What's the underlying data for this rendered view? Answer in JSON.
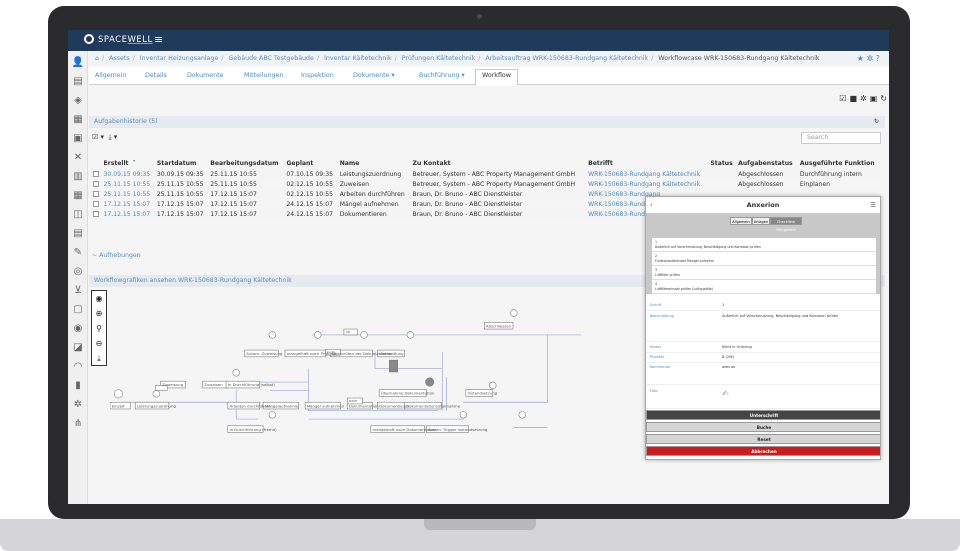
{
  "app": {
    "logo_left": "SPACE",
    "logo_right": "WELL"
  },
  "breadcrumb": [
    "Assets",
    "Inventar Heizungsanlage",
    "Gebäude ABC Testgebäude",
    "Inventar Kältetechnik",
    "Prüfungen Kältetechnik",
    "Arbeitsauftrag WRK-150683-Rundgang Kältetechnik",
    "Workflowcase WRK-150683-Rundgang Kältetechnik"
  ],
  "tabs": [
    "Allgemein",
    "Details",
    "Dokumente",
    "Mitteilungen",
    "Inspektion",
    "Dokumente ▾",
    "Buchführung ▾",
    "Workflow"
  ],
  "history": {
    "title": "Aufgabenhistorie (5)",
    "search_placeholder": "Search",
    "columns": [
      "Erstellt",
      "Startdatum",
      "Bearbeitungsdatum",
      "Geplant",
      "Name",
      "Zu Kontakt",
      "Betrifft",
      "Status",
      "Aufgabenstatus",
      "Ausgeführte Funktion"
    ],
    "rows": [
      [
        "30.09.15 09:35",
        "30.09.15 09:35",
        "25.11.15 10:55",
        "07.10.15 09:35",
        "Leistungszuordnung",
        "Betreuer, System - ABC Property Management GmbH",
        "WRK-150683-Rundgang Kältetechnik",
        "",
        "Abgeschlossen",
        "Durchführung intern"
      ],
      [
        "25.11.15 10:55",
        "25.11.15 10:55",
        "25.11.15 10:55",
        "02.12.15 10:55",
        "Zuweisen",
        "Betreuer, System - ABC Property Management GmbH",
        "WRK-150683-Rundgang Kältetechnik",
        "",
        "Abgeschlossen",
        "Einplanen"
      ],
      [
        "25.11.15 10:55",
        "25.11.15 10:55",
        "17.12.15 15:07",
        "02.12.15 10:55",
        "Arbeiten durchführen",
        "Braun, Dr. Bruno - ABC Dienstleister",
        "WRK-150683-Rundgang",
        "",
        "",
        ""
      ],
      [
        "17.12.15 15:07",
        "17.12.15 15:07",
        "17.12.15 15:07",
        "24.12.15 15:07",
        "Mängel aufnehmen",
        "Braun, Dr. Bruno - ABC Dienstleister",
        "WRK-150683-Rundgang",
        "",
        "",
        ""
      ],
      [
        "17.12.15 15:07",
        "17.12.15 15:07",
        "17.12.15 15:07",
        "24.12.15 15:07",
        "Dokumentieren",
        "Braun, Dr. Bruno - ABC Dienstleister",
        "WRK-150683-Rundgang",
        "",
        "",
        ""
      ]
    ]
  },
  "aufhebungen": "~ Aufhebungen",
  "workflow": {
    "title": "Workflowgrafiken ansehen WRK-150683-Rundgang Kältetechnik",
    "labels": {
      "ja": "Ja",
      "nein": "nein",
      "l1": "Autom. Zuweisung",
      "l2": "mangelhaft nach Prüfung",
      "l3": "Überprüfen der Dokumentation",
      "l4": "Überprüfung",
      "l5": "Zuweisung",
      "l6": "Zuweisen",
      "l7": "In Durchführung (selbst)",
      "l8": "Einzelf",
      "l9": "Leistungszuordnung",
      "l10": "Arbeiten durchführen",
      "l11": "Mängelaufnahme",
      "l12": "Mängel aufnehmen",
      "l13": "Dokumentation",
      "l14": "Dokumentieren",
      "l15": "Dokumentationsübernahme",
      "l16": "Übernahme Dokumentation",
      "l17": "In Durchführung (fremd)",
      "l18": "mangelhaft nach Dokumentation",
      "l19": "Autom. Trigger Instandsetzung",
      "l20": "Abschliessen",
      "l21": "Instandsetzung"
    }
  },
  "dialog": {
    "title": "Anxerion",
    "back": "‹",
    "menu": "☰",
    "segments": [
      "Allgemein",
      "Anlagen",
      "Checkliste Mängelfeld"
    ],
    "items": [
      {
        "n": "1",
        "t": "Äußerlich auf Verschmutzung, Beschädigung und Korrosion prüfen"
      },
      {
        "n": "2",
        "t": "Funktionsstörendes Mangel aufnehm"
      },
      {
        "n": "3",
        "t": "Luftfilter prüfen"
      },
      {
        "n": "4",
        "t": "Luftfiltereinsatz prüfen (Luftqualität)"
      }
    ],
    "fields": [
      {
        "k": "Schritt",
        "v": "1"
      },
      {
        "k": "Beschreibung",
        "v": "Äußerlich auf Verschmutzung, Beschädigung und Korrosion prüfen"
      },
      {
        "k": "Status",
        "v": "Nicht in Ordnung"
      },
      {
        "k": "Priorität",
        "v": "B (2W)"
      },
      {
        "k": "Kommentar",
        "v": "alles ok"
      },
      {
        "k": "Foto",
        "v": ""
      }
    ],
    "buttons": [
      "Unterschrift",
      "Buche",
      "Reset",
      "Abbrechen"
    ]
  },
  "colors": {
    "topbar": "#1f3a5a",
    "link": "#4a8bc9",
    "cancel": "#cc1c1c"
  }
}
